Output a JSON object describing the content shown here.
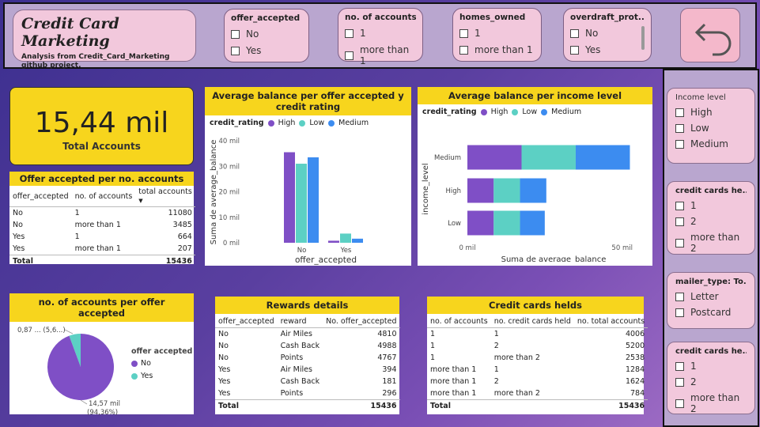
{
  "header": {
    "title": "Credit Card Marketing",
    "subtitle": "Analysis from Credit_Card_Marketing github project."
  },
  "slicers_top": [
    {
      "label": "offer_accepted",
      "options": [
        "No",
        "Yes"
      ]
    },
    {
      "label": "no. of accounts",
      "options": [
        "1",
        "more than 1"
      ]
    },
    {
      "label": "homes_owned",
      "options": [
        "1",
        "more than 1"
      ]
    },
    {
      "label": "overdraft_prot...",
      "options": [
        "No",
        "Yes"
      ]
    }
  ],
  "slicers_right": [
    {
      "label": "Income level",
      "options": [
        "High",
        "Low",
        "Medium"
      ]
    },
    {
      "label": "credit cards he...",
      "options": [
        "1",
        "2",
        "more than 2"
      ]
    },
    {
      "label": "mailer_type: To...",
      "options": [
        "Letter",
        "Postcard"
      ]
    },
    {
      "label": "credit cards he...",
      "options": [
        "1",
        "2",
        "more than 2"
      ]
    }
  ],
  "kpi": {
    "value": "15,44 mil",
    "label": "Total Accounts"
  },
  "colors": {
    "high": "#7f4fc6",
    "low": "#5cd0c4",
    "medium": "#3c8cf0",
    "yellow": "#f7d51d",
    "no": "#7f4fc6",
    "yes": "#5cd0c4"
  },
  "offer_table": {
    "title": "Offer accepted per no. accounts",
    "headers": [
      "offer_accepted",
      "no. of accounts",
      "total accounts"
    ],
    "rows": [
      [
        "No",
        "1",
        "11080"
      ],
      [
        "No",
        "more than 1",
        "3485"
      ],
      [
        "Yes",
        "1",
        "664"
      ],
      [
        "Yes",
        "more than 1",
        "207"
      ]
    ],
    "total_label": "Total",
    "total_value": "15436"
  },
  "rewards_table": {
    "title": "Rewards details",
    "headers": [
      "offer_accepted",
      "reward",
      "No. offer_accepted"
    ],
    "rows": [
      [
        "No",
        "Air Miles",
        "4810"
      ],
      [
        "No",
        "Cash Back",
        "4988"
      ],
      [
        "No",
        "Points",
        "4767"
      ],
      [
        "Yes",
        "Air Miles",
        "394"
      ],
      [
        "Yes",
        "Cash Back",
        "181"
      ],
      [
        "Yes",
        "Points",
        "296"
      ]
    ],
    "total_label": "Total",
    "total_value": "15436"
  },
  "cards_table": {
    "title": "Credit cards helds",
    "headers": [
      "no. of accounts",
      "no. credit cards held",
      "no. total accounts"
    ],
    "rows": [
      [
        "1",
        "1",
        "4006"
      ],
      [
        "1",
        "2",
        "5200"
      ],
      [
        "1",
        "more than 2",
        "2538"
      ],
      [
        "more than 1",
        "1",
        "1284"
      ],
      [
        "more than 1",
        "2",
        "1624"
      ],
      [
        "more than 1",
        "more than 2",
        "784"
      ]
    ],
    "total_label": "Total",
    "total_value": "15436"
  },
  "chart_data": [
    {
      "type": "bar",
      "title": "Average balance per offer accepted y credit rating",
      "legend_title": "credit_rating",
      "categories": [
        "No",
        "Yes"
      ],
      "series": [
        {
          "name": "High",
          "values": [
            35.5,
            0.8
          ]
        },
        {
          "name": "Low",
          "values": [
            31,
            3.6
          ]
        },
        {
          "name": "Medium",
          "values": [
            33.5,
            1.6
          ]
        }
      ],
      "xlabel": "offer_accepted",
      "ylabel": "Suma de average_balance",
      "yticks": [
        "0 mil",
        "10 mil",
        "20 mil",
        "30 mil",
        "40 mil"
      ],
      "ylim": [
        0,
        40
      ],
      "legend_position": "top-left"
    },
    {
      "type": "bar",
      "orientation": "horizontal",
      "stacked": true,
      "title": "Average balance per income level",
      "legend_title": "credit_rating",
      "categories": [
        "Medium",
        "High",
        "Low"
      ],
      "series": [
        {
          "name": "High",
          "values": [
            17.5,
            8.5,
            8.5
          ]
        },
        {
          "name": "Low",
          "values": [
            17.5,
            8.5,
            8.5
          ]
        },
        {
          "name": "Medium",
          "values": [
            17.5,
            8.5,
            8
          ]
        }
      ],
      "xlabel": "Suma de average_balance",
      "ylabel": "income_level",
      "xticks": [
        "0 mil",
        "50 mil"
      ],
      "xlim": [
        0,
        58
      ],
      "legend_position": "top-left"
    },
    {
      "type": "pie",
      "title": "no. of accounts per offer accepted",
      "legend_title": "offer accepted",
      "categories": [
        "No",
        "Yes"
      ],
      "values": [
        94.36,
        5.64
      ],
      "labels": [
        "14,57 mil (94,36%)",
        "0,87 ... (5,6...)"
      ]
    }
  ]
}
